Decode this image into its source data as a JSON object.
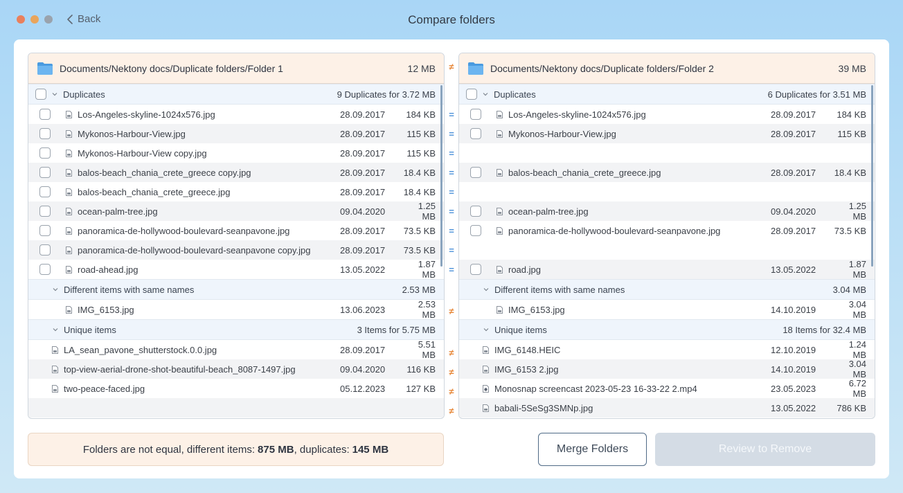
{
  "window": {
    "title": "Compare folders",
    "back_label": "Back"
  },
  "left": {
    "path": "Documents/Nektony docs/Duplicate folders/Folder 1",
    "size": "12 MB",
    "duplicates": {
      "label": "Duplicates",
      "meta": "9 Duplicates for 3.72 MB",
      "rows": [
        {
          "name": "Los-Angeles-skyline-1024x576.jpg",
          "date": "28.09.2017",
          "size": "184 KB"
        },
        {
          "name": "Mykonos-Harbour-View.jpg",
          "date": "28.09.2017",
          "size": "115 KB"
        },
        {
          "name": "Mykonos-Harbour-View copy.jpg",
          "date": "28.09.2017",
          "size": "115 KB"
        },
        {
          "name": "balos-beach_chania_crete_greece copy.jpg",
          "date": "28.09.2017",
          "size": "18.4 KB"
        },
        {
          "name": "balos-beach_chania_crete_greece.jpg",
          "date": "28.09.2017",
          "size": "18.4 KB"
        },
        {
          "name": "ocean-palm-tree.jpg",
          "date": "09.04.2020",
          "size": "1.25 MB"
        },
        {
          "name": "panoramica-de-hollywood-boulevard-seanpavone.jpg",
          "date": "28.09.2017",
          "size": "73.5 KB"
        },
        {
          "name": "panoramica-de-hollywood-boulevard-seanpavone copy.jpg",
          "date": "28.09.2017",
          "size": "73.5 KB"
        },
        {
          "name": "road-ahead.jpg",
          "date": "13.05.2022",
          "size": "1.87 MB"
        }
      ]
    },
    "different": {
      "label": "Different items with same names",
      "meta": "2.53 MB",
      "rows": [
        {
          "name": "IMG_6153.jpg",
          "date": "13.06.2023",
          "size": "2.53 MB"
        }
      ]
    },
    "unique": {
      "label": "Unique items",
      "meta": "3 Items for 5.75 MB",
      "rows": [
        {
          "name": "LA_sean_pavone_shutterstock.0.0.jpg",
          "date": "28.09.2017",
          "size": "5.51 MB"
        },
        {
          "name": "top-view-aerial-drone-shot-beautiful-beach_8087-1497.jpg",
          "date": "09.04.2020",
          "size": "116 KB"
        },
        {
          "name": "two-peace-faced.jpg",
          "date": "05.12.2023",
          "size": "127 KB"
        }
      ]
    }
  },
  "right": {
    "path": "Documents/Nektony docs/Duplicate folders/Folder 2",
    "size": "39 MB",
    "duplicates": {
      "label": "Duplicates",
      "meta": "6 Duplicates for 3.51 MB",
      "rows": [
        {
          "name": "Los-Angeles-skyline-1024x576.jpg",
          "date": "28.09.2017",
          "size": "184 KB"
        },
        {
          "name": "Mykonos-Harbour-View.jpg",
          "date": "28.09.2017",
          "size": "115 KB"
        },
        {
          "name": "balos-beach_chania_crete_greece.jpg",
          "date": "28.09.2017",
          "size": "18.4 KB"
        },
        {
          "name": "ocean-palm-tree.jpg",
          "date": "09.04.2020",
          "size": "1.25 MB"
        },
        {
          "name": "panoramica-de-hollywood-boulevard-seanpavone.jpg",
          "date": "28.09.2017",
          "size": "73.5 KB"
        },
        {
          "name": "road.jpg",
          "date": "13.05.2022",
          "size": "1.87 MB"
        }
      ]
    },
    "different": {
      "label": "Different items with same names",
      "meta": "3.04 MB",
      "rows": [
        {
          "name": "IMG_6153.jpg",
          "date": "14.10.2019",
          "size": "3.04 MB"
        }
      ]
    },
    "unique": {
      "label": "Unique items",
      "meta": "18 Items for 32.4 MB",
      "rows": [
        {
          "name": "IMG_6148.HEIC",
          "date": "12.10.2019",
          "size": "1.24 MB"
        },
        {
          "name": "IMG_6153 2.jpg",
          "date": "14.10.2019",
          "size": "3.04 MB"
        },
        {
          "name": "Monosnap screencast 2023-05-23 16-33-22 2.mp4",
          "date": "23.05.2023",
          "size": "6.72 MB"
        },
        {
          "name": "babali-5SeSg3SMNp.jpg",
          "date": "13.05.2022",
          "size": "786 KB"
        }
      ]
    }
  },
  "compare": {
    "header": "≠",
    "equal": "=",
    "notequal": "≠"
  },
  "status": {
    "prefix": "Folders are not equal, different items:",
    "different_value": "875 MB",
    "mid": ", duplicates:",
    "duplicates_value": "145 MB"
  },
  "buttons": {
    "merge": "Merge Folders",
    "review": "Review to Remove"
  },
  "colors": {
    "accent": "#4a90d9",
    "notequal": "#e7883a",
    "header_bg": "#fdf1e7"
  }
}
